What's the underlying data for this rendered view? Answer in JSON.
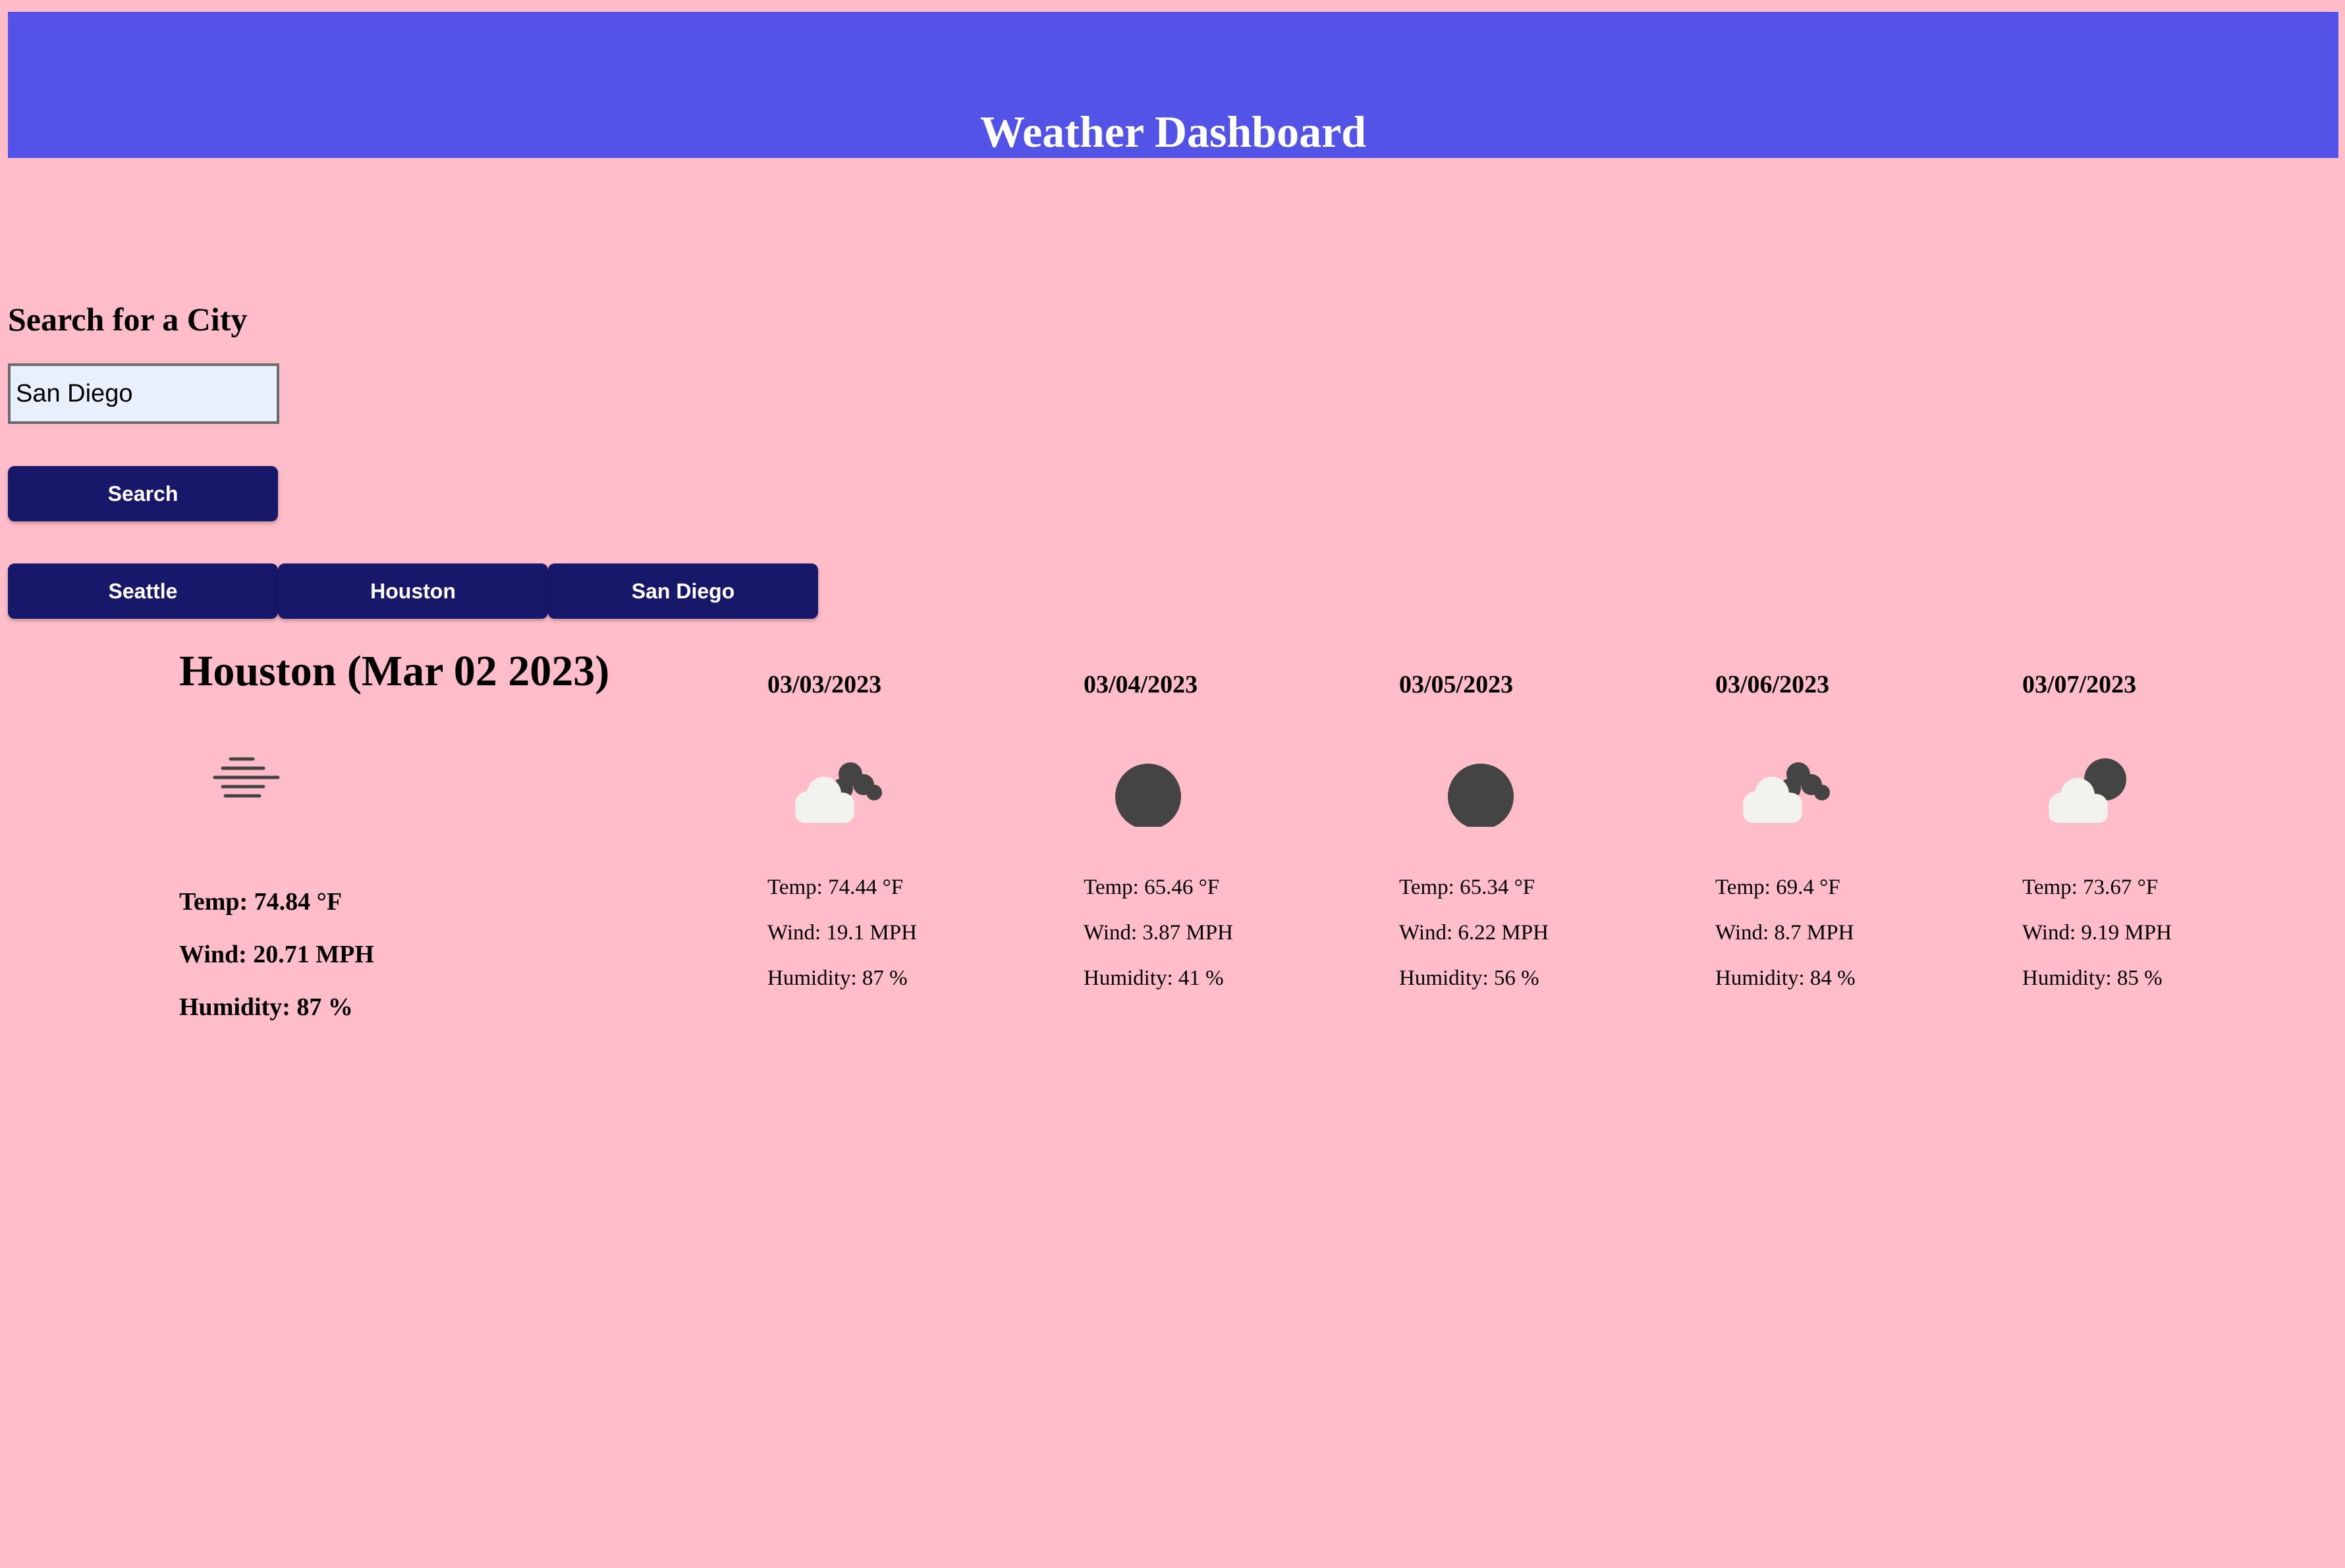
{
  "header": {
    "title": "Weather Dashboard"
  },
  "search": {
    "heading": "Search for a City",
    "input_value": "San Diego",
    "button_label": "Search"
  },
  "history": [
    {
      "label": "Seattle"
    },
    {
      "label": "Houston"
    },
    {
      "label": "San Diego"
    }
  ],
  "current": {
    "title": "Houston (Mar 02 2023)",
    "icon": "mist-icon",
    "temp": "Temp: 74.84 °F",
    "wind": "Wind: 20.71 MPH",
    "humidity": "Humidity: 87 %"
  },
  "forecast": [
    {
      "date": "03/03/2023",
      "icon": "broken-clouds-icon",
      "temp": "Temp: 74.44 °F",
      "wind": "Wind: 19.1 MPH",
      "humidity": "Humidity: 87 %"
    },
    {
      "date": "03/04/2023",
      "icon": "clear-sky-icon",
      "temp": "Temp: 65.46 °F",
      "wind": "Wind: 3.87 MPH",
      "humidity": "Humidity: 41 %"
    },
    {
      "date": "03/05/2023",
      "icon": "clear-sky-icon",
      "temp": "Temp: 65.34 °F",
      "wind": "Wind: 6.22 MPH",
      "humidity": "Humidity: 56 %"
    },
    {
      "date": "03/06/2023",
      "icon": "broken-clouds-icon",
      "temp": "Temp: 69.4 °F",
      "wind": "Wind: 8.7 MPH",
      "humidity": "Humidity: 84 %"
    },
    {
      "date": "03/07/2023",
      "icon": "few-clouds-icon",
      "temp": "Temp: 73.67 °F",
      "wind": "Wind: 9.19 MPH",
      "humidity": "Humidity: 85 %"
    }
  ],
  "colors": {
    "page_bg": "#ffbdca",
    "header_bg": "#5353e8",
    "button_bg": "#18186b",
    "icon_dark": "#444444",
    "icon_light": "#f2f2ee"
  }
}
